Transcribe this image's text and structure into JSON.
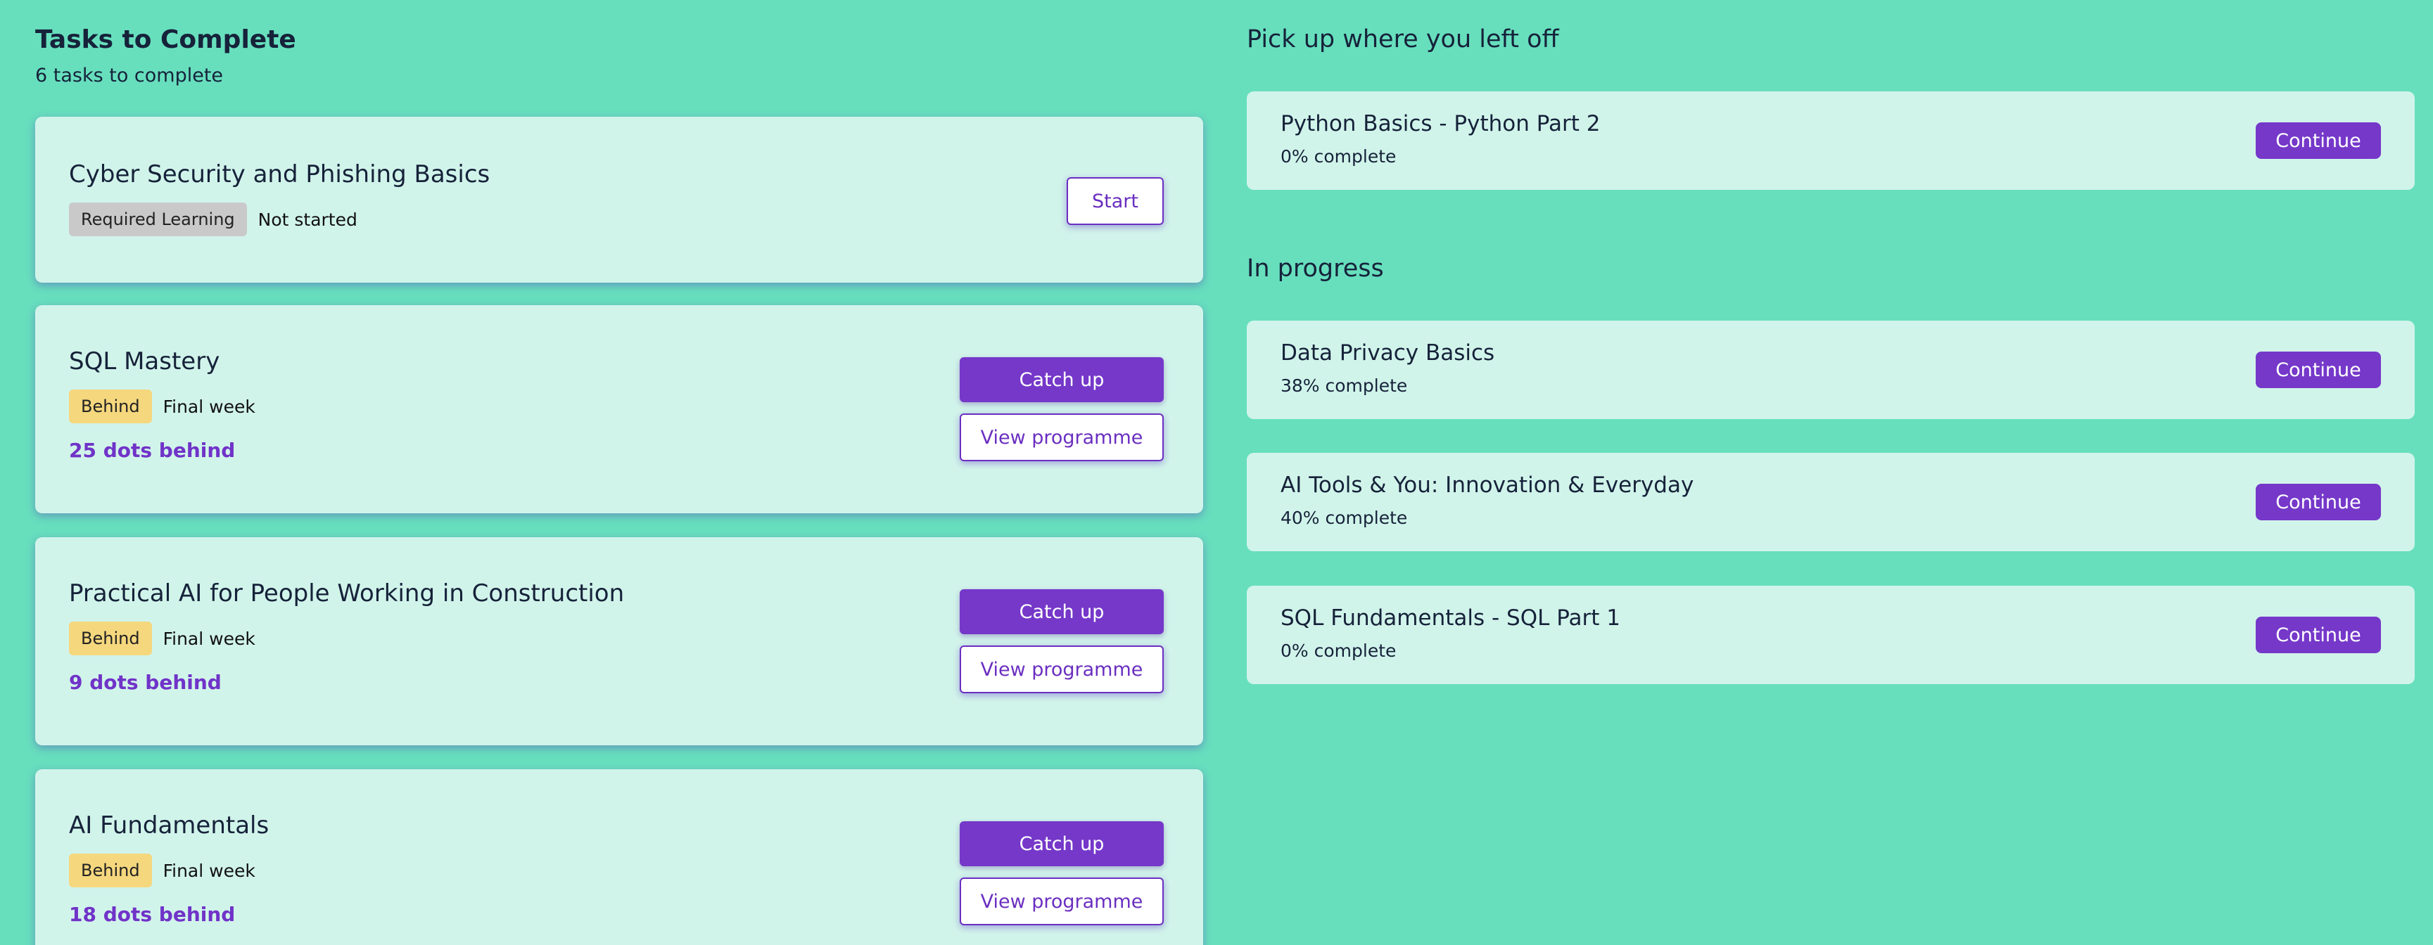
{
  "tasks": {
    "title": "Tasks to Complete",
    "count_text": "6 tasks to complete",
    "items": [
      {
        "title": "Cyber Security and Phishing Basics",
        "tag": "Required Learning",
        "status": "Not started",
        "start_label": "Start"
      },
      {
        "title": "SQL Mastery",
        "tag": "Behind",
        "status": "Final week",
        "dots_behind": "25 dots behind",
        "catch_up_label": "Catch up",
        "view_label": "View programme"
      },
      {
        "title": "Practical AI for People Working in Construction",
        "tag": "Behind",
        "status": "Final week",
        "dots_behind": "9 dots behind",
        "catch_up_label": "Catch up",
        "view_label": "View programme"
      },
      {
        "title": "AI Fundamentals",
        "tag": "Behind",
        "status": "Final week",
        "dots_behind": "18 dots behind",
        "catch_up_label": "Catch up",
        "view_label": "View programme"
      }
    ]
  },
  "resume": {
    "title": "Pick up where you left off",
    "item": {
      "name": "Python Basics - Python Part 2",
      "progress": "0% complete",
      "button": "Continue"
    }
  },
  "in_progress": {
    "title": "In progress",
    "items": [
      {
        "name": "Data Privacy Basics",
        "progress": "38% complete",
        "button": "Continue"
      },
      {
        "name": "AI Tools & You: Innovation & Everyday",
        "progress": "40% complete",
        "button": "Continue"
      },
      {
        "name": "SQL Fundamentals - SQL Part 1",
        "progress": "0% complete",
        "button": "Continue"
      }
    ]
  },
  "colors": {
    "background": "#67dfbd",
    "card": "#d1f4ea",
    "accent": "#7538c9",
    "behind_tag": "#f5d77e",
    "required_tag": "#c9c9c9"
  }
}
